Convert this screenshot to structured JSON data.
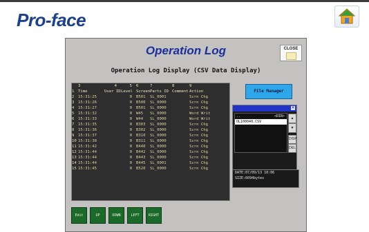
{
  "header": {
    "brand": "Pro-face",
    "home_icon": "home-icon"
  },
  "hmi": {
    "title": "Operation Log",
    "close_label": "CLOSE",
    "subtitle": "Operation Log Display (CSV Data Display)",
    "table": {
      "column_numbers": [
        "3",
        "4",
        "5",
        "6",
        "7",
        "8",
        "9"
      ],
      "headers": [
        "Time",
        "User ID",
        "Level",
        "Screen",
        "Parts ID",
        "Comment",
        "Action"
      ],
      "rows": [
        [
          "2",
          "15:31:25",
          "",
          "0",
          "B501",
          "SL_0001",
          "",
          "Scrn Chg"
        ],
        [
          "3",
          "15:31:26",
          "",
          "0",
          "B500",
          "SL_0000",
          "",
          "Scrn Chg"
        ],
        [
          "4",
          "15:31:27",
          "",
          "0",
          "B501",
          "SL_0000",
          "",
          "Scrn Chg"
        ],
        [
          "5",
          "15:31:32",
          "",
          "0",
          "W45",
          "SL_0000",
          "",
          "Word Writ"
        ],
        [
          "6",
          "15:31:33",
          "",
          "0",
          "W44",
          "SL_0000",
          "",
          "Word Writ"
        ],
        [
          "7",
          "15:31:35",
          "",
          "0",
          "B303",
          "SL_0000",
          "",
          "Scrn Chg"
        ],
        [
          "8",
          "15:31:36",
          "",
          "0",
          "B302",
          "SL_0000",
          "",
          "Scrn Chg"
        ],
        [
          "9",
          "15:31:37",
          "",
          "0",
          "B310",
          "SL_0000",
          "",
          "Scrn Chg"
        ],
        [
          "10",
          "15:31:38",
          "",
          "0",
          "B311",
          "SL_0000",
          "",
          "Scrn Chg"
        ],
        [
          "11",
          "15:31:42",
          "",
          "0",
          "B440",
          "SL_0000",
          "",
          "Scrn Chg"
        ],
        [
          "12",
          "15:31:44",
          "",
          "0",
          "B442",
          "SL_0000",
          "",
          "Scrn Chg"
        ],
        [
          "13",
          "15:31:44",
          "",
          "0",
          "B443",
          "SL_0000",
          "",
          "Scrn Chg"
        ],
        [
          "14",
          "15:31:44",
          "",
          "0",
          "B445",
          "SL_0001",
          "",
          "Scrn Chg"
        ],
        [
          "15",
          "15:31:45",
          "",
          "0",
          "B520",
          "SL_0000",
          "",
          "Scrn Chg"
        ]
      ],
      "header_row_number": "1"
    },
    "file_manager": {
      "button_label": "File Manager",
      "list": [
        {
          "name": "..",
          "type": "<DIR>"
        },
        {
          "name": "OL100040.CSV",
          "type": ""
        }
      ],
      "side_buttons": [
        "▲",
        "▼",
        "DISP",
        "DEL"
      ],
      "date": "DATE:07/09/13 10:06",
      "size": "SIZE:6094bytes"
    },
    "bottom_buttons": [
      "Edit",
      "UP",
      "DOWN",
      "LEFT",
      "RIGHT"
    ]
  }
}
